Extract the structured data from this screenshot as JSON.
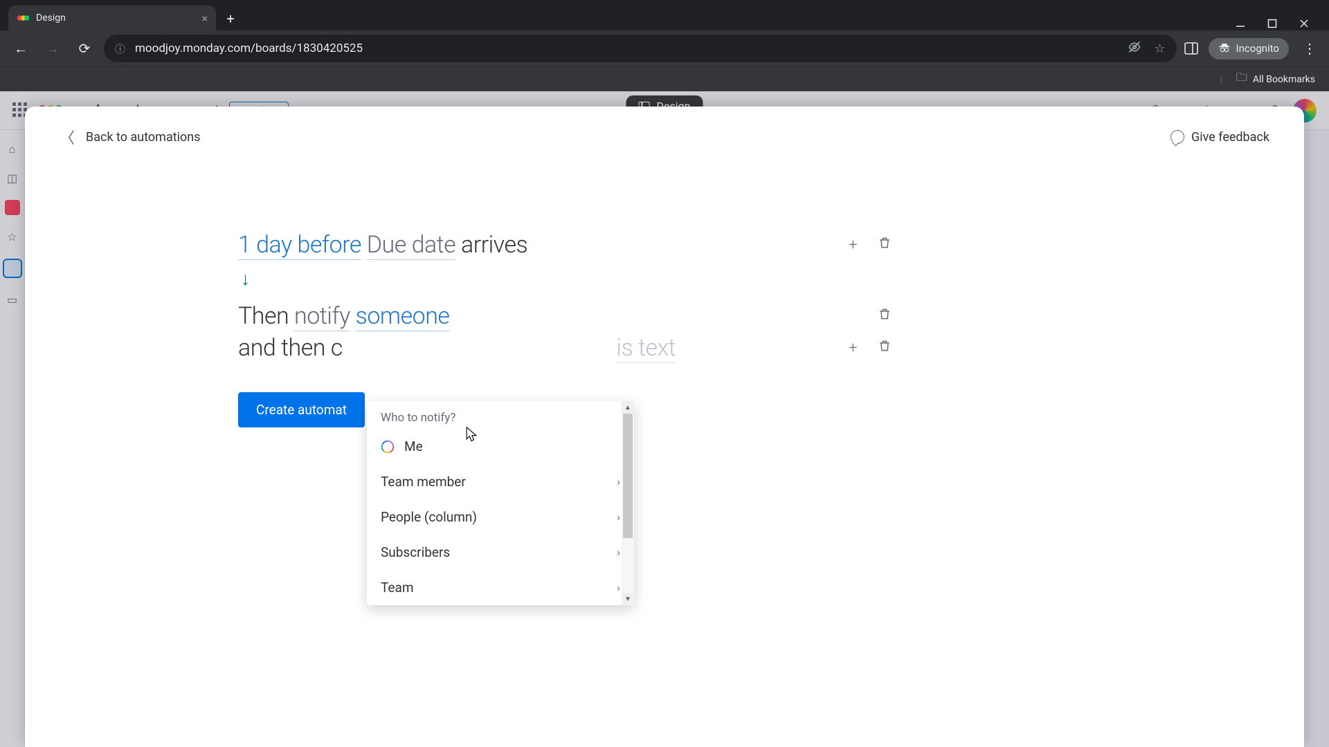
{
  "browser": {
    "tab_title": "Design",
    "url": "moodjoy.monday.com/boards/1830420525",
    "incognito_label": "Incognito",
    "all_bookmarks": "All Bookmarks"
  },
  "bg": {
    "product_name_bold": "monday",
    "product_name_rest": "work management",
    "see_plans": "See plans"
  },
  "float_pill": "Design",
  "modal": {
    "back": "Back to automations",
    "feedback": "Give feedback",
    "create_button": "Create automat"
  },
  "rule1": {
    "part1": "1 day before",
    "part2": "Due date",
    "part3": " arrives"
  },
  "rule2": {
    "pre": "Then ",
    "notify": "notify",
    "space": " ",
    "someone": "someone"
  },
  "rule3": {
    "pre": "and then c",
    "hidden_tail": "is text"
  },
  "popover": {
    "title": "Who to notify?",
    "items": [
      {
        "label": "Me",
        "has_chevron": false,
        "is_me": true
      },
      {
        "label": "Team member",
        "has_chevron": true,
        "is_me": false
      },
      {
        "label": "People (column)",
        "has_chevron": true,
        "is_me": false
      },
      {
        "label": "Subscribers",
        "has_chevron": true,
        "is_me": false
      },
      {
        "label": "Team",
        "has_chevron": true,
        "is_me": false
      }
    ]
  }
}
